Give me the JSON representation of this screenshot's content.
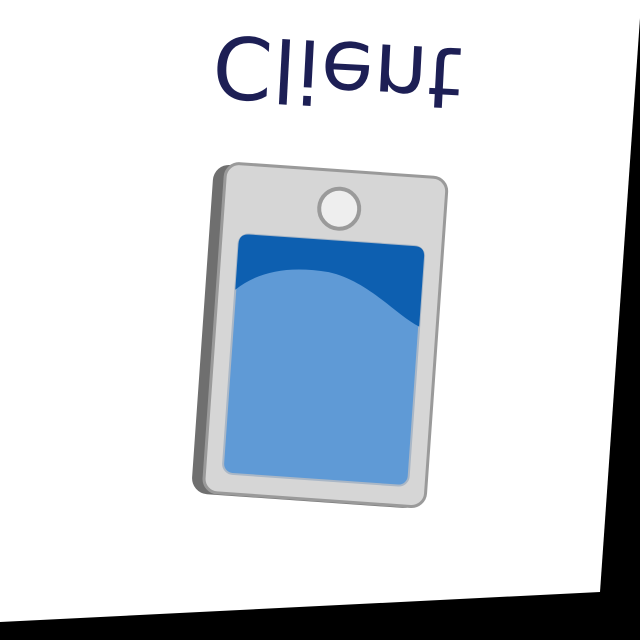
{
  "label": {
    "text": "Client"
  },
  "icon": {
    "name": "mobile-device-icon"
  },
  "colors": {
    "background": "#ffffff",
    "frame": "#000000",
    "device_body": "#d6d6d6",
    "device_edge": "#6f6f6f",
    "screen_light": "#5f9ad6",
    "screen_dark": "#0d5fb0",
    "text": "#1d1f55"
  }
}
